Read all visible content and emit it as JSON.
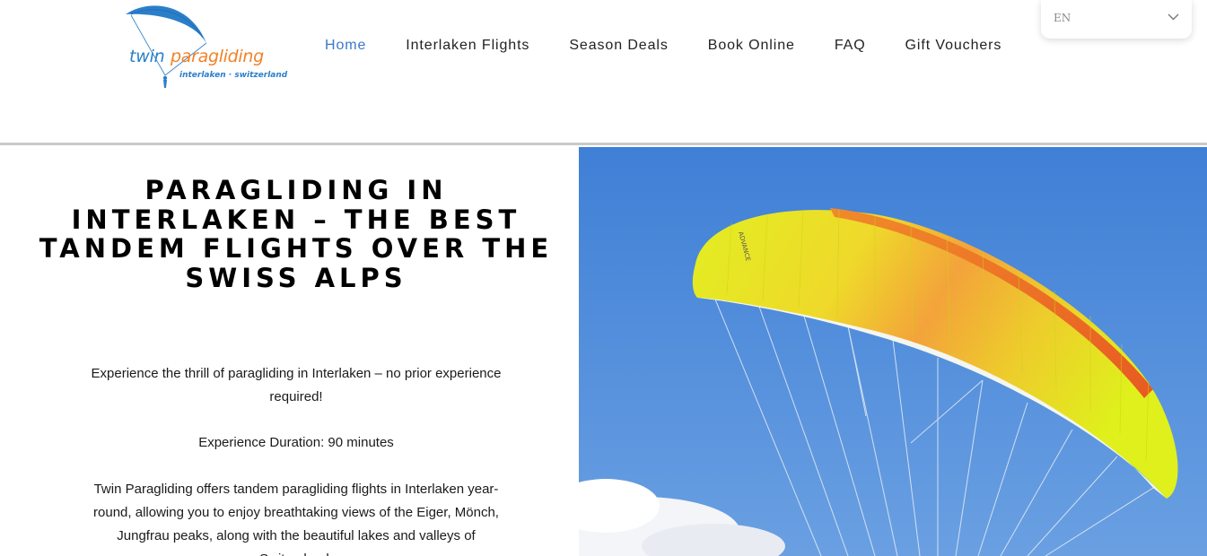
{
  "header": {
    "logo": {
      "word1": "twin",
      "word2": "paragliding",
      "tagline": "interlaken · switzerland"
    },
    "nav": [
      {
        "label": "Home",
        "active": true
      },
      {
        "label": "Interlaken Flights",
        "active": false
      },
      {
        "label": "Season Deals",
        "active": false
      },
      {
        "label": "Book Online",
        "active": false
      },
      {
        "label": "FAQ",
        "active": false
      },
      {
        "label": "Gift Vouchers",
        "active": false
      }
    ],
    "language": {
      "selected": "EN",
      "icon": "chevron-down-icon"
    }
  },
  "main": {
    "title": "Paragliding in Interlaken – The Best Tandem Flights Over the Swiss Alps",
    "intro": "Experience the thrill of paragliding in Interlaken – no prior experience required!",
    "duration": "Experience Duration: 90 minutes",
    "description": "Twin Paragliding offers tandem paragliding flights in Interlaken year-round, allowing you to enjoy breathtaking views of the Eiger, Mönch, Jungfrau peaks, along with the beautiful lakes and valleys of Switzerland.",
    "hero_brand": "ADVANCE"
  },
  "colors": {
    "accent": "#3c78c8",
    "logo_blue": "#2b7fc9",
    "logo_orange": "#f08228",
    "sky": "#4a86d8",
    "wing_yellow": "#e4f01a",
    "wing_orange": "#f08a2a"
  }
}
